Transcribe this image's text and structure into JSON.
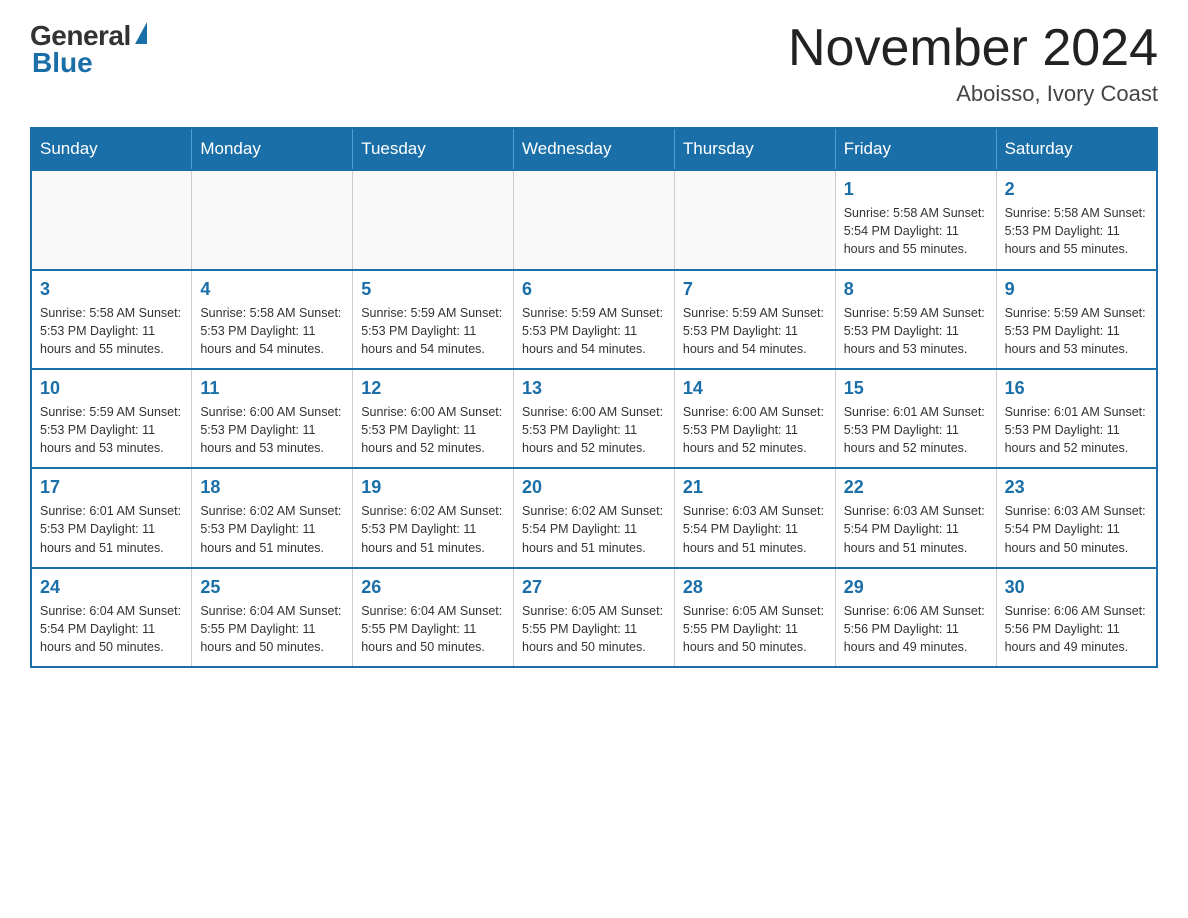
{
  "logo": {
    "general": "General",
    "blue": "Blue"
  },
  "title": "November 2024",
  "subtitle": "Aboisso, Ivory Coast",
  "days_of_week": [
    "Sunday",
    "Monday",
    "Tuesday",
    "Wednesday",
    "Thursday",
    "Friday",
    "Saturday"
  ],
  "weeks": [
    [
      {
        "day": "",
        "info": ""
      },
      {
        "day": "",
        "info": ""
      },
      {
        "day": "",
        "info": ""
      },
      {
        "day": "",
        "info": ""
      },
      {
        "day": "",
        "info": ""
      },
      {
        "day": "1",
        "info": "Sunrise: 5:58 AM\nSunset: 5:54 PM\nDaylight: 11 hours and 55 minutes."
      },
      {
        "day": "2",
        "info": "Sunrise: 5:58 AM\nSunset: 5:53 PM\nDaylight: 11 hours and 55 minutes."
      }
    ],
    [
      {
        "day": "3",
        "info": "Sunrise: 5:58 AM\nSunset: 5:53 PM\nDaylight: 11 hours and 55 minutes."
      },
      {
        "day": "4",
        "info": "Sunrise: 5:58 AM\nSunset: 5:53 PM\nDaylight: 11 hours and 54 minutes."
      },
      {
        "day": "5",
        "info": "Sunrise: 5:59 AM\nSunset: 5:53 PM\nDaylight: 11 hours and 54 minutes."
      },
      {
        "day": "6",
        "info": "Sunrise: 5:59 AM\nSunset: 5:53 PM\nDaylight: 11 hours and 54 minutes."
      },
      {
        "day": "7",
        "info": "Sunrise: 5:59 AM\nSunset: 5:53 PM\nDaylight: 11 hours and 54 minutes."
      },
      {
        "day": "8",
        "info": "Sunrise: 5:59 AM\nSunset: 5:53 PM\nDaylight: 11 hours and 53 minutes."
      },
      {
        "day": "9",
        "info": "Sunrise: 5:59 AM\nSunset: 5:53 PM\nDaylight: 11 hours and 53 minutes."
      }
    ],
    [
      {
        "day": "10",
        "info": "Sunrise: 5:59 AM\nSunset: 5:53 PM\nDaylight: 11 hours and 53 minutes."
      },
      {
        "day": "11",
        "info": "Sunrise: 6:00 AM\nSunset: 5:53 PM\nDaylight: 11 hours and 53 minutes."
      },
      {
        "day": "12",
        "info": "Sunrise: 6:00 AM\nSunset: 5:53 PM\nDaylight: 11 hours and 52 minutes."
      },
      {
        "day": "13",
        "info": "Sunrise: 6:00 AM\nSunset: 5:53 PM\nDaylight: 11 hours and 52 minutes."
      },
      {
        "day": "14",
        "info": "Sunrise: 6:00 AM\nSunset: 5:53 PM\nDaylight: 11 hours and 52 minutes."
      },
      {
        "day": "15",
        "info": "Sunrise: 6:01 AM\nSunset: 5:53 PM\nDaylight: 11 hours and 52 minutes."
      },
      {
        "day": "16",
        "info": "Sunrise: 6:01 AM\nSunset: 5:53 PM\nDaylight: 11 hours and 52 minutes."
      }
    ],
    [
      {
        "day": "17",
        "info": "Sunrise: 6:01 AM\nSunset: 5:53 PM\nDaylight: 11 hours and 51 minutes."
      },
      {
        "day": "18",
        "info": "Sunrise: 6:02 AM\nSunset: 5:53 PM\nDaylight: 11 hours and 51 minutes."
      },
      {
        "day": "19",
        "info": "Sunrise: 6:02 AM\nSunset: 5:53 PM\nDaylight: 11 hours and 51 minutes."
      },
      {
        "day": "20",
        "info": "Sunrise: 6:02 AM\nSunset: 5:54 PM\nDaylight: 11 hours and 51 minutes."
      },
      {
        "day": "21",
        "info": "Sunrise: 6:03 AM\nSunset: 5:54 PM\nDaylight: 11 hours and 51 minutes."
      },
      {
        "day": "22",
        "info": "Sunrise: 6:03 AM\nSunset: 5:54 PM\nDaylight: 11 hours and 51 minutes."
      },
      {
        "day": "23",
        "info": "Sunrise: 6:03 AM\nSunset: 5:54 PM\nDaylight: 11 hours and 50 minutes."
      }
    ],
    [
      {
        "day": "24",
        "info": "Sunrise: 6:04 AM\nSunset: 5:54 PM\nDaylight: 11 hours and 50 minutes."
      },
      {
        "day": "25",
        "info": "Sunrise: 6:04 AM\nSunset: 5:55 PM\nDaylight: 11 hours and 50 minutes."
      },
      {
        "day": "26",
        "info": "Sunrise: 6:04 AM\nSunset: 5:55 PM\nDaylight: 11 hours and 50 minutes."
      },
      {
        "day": "27",
        "info": "Sunrise: 6:05 AM\nSunset: 5:55 PM\nDaylight: 11 hours and 50 minutes."
      },
      {
        "day": "28",
        "info": "Sunrise: 6:05 AM\nSunset: 5:55 PM\nDaylight: 11 hours and 50 minutes."
      },
      {
        "day": "29",
        "info": "Sunrise: 6:06 AM\nSunset: 5:56 PM\nDaylight: 11 hours and 49 minutes."
      },
      {
        "day": "30",
        "info": "Sunrise: 6:06 AM\nSunset: 5:56 PM\nDaylight: 11 hours and 49 minutes."
      }
    ]
  ]
}
